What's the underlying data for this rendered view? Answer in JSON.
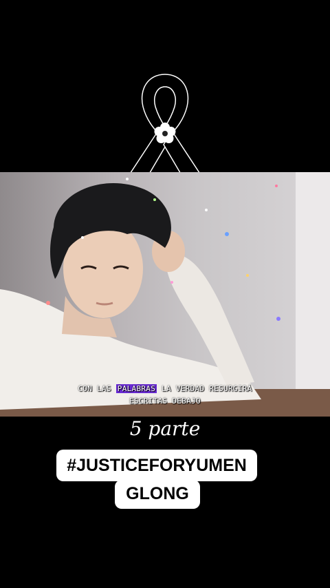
{
  "ribbon": {
    "icon": "mourning-ribbon-icon",
    "flower_icon": "white-flower-icon",
    "color": "#000000"
  },
  "subtitle": {
    "before": "CON LAS ",
    "highlight": "PALABRAS",
    "after": " LA VERDAD RESURGIRÁ",
    "line2": "ESCRITAS DEBAJO",
    "highlight_color": "#6a2ad6"
  },
  "part_label": "5 parte",
  "hashtag": {
    "line1": "#JUSTICEFORYUMEN",
    "line2": "GLONG"
  }
}
